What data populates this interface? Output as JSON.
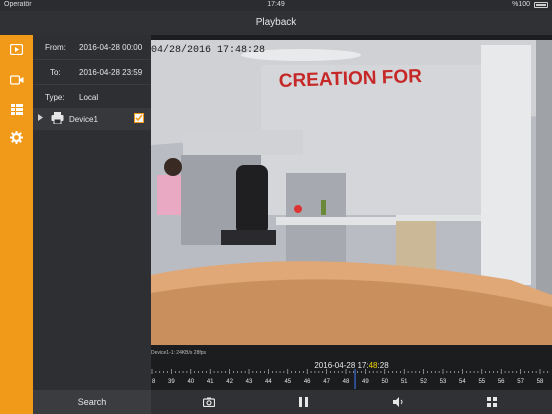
{
  "status": {
    "carrier": "Operatör",
    "time": "17:49",
    "battery": "%100"
  },
  "title": "Playback",
  "rail": {
    "icons": [
      "playback-icon",
      "camera-icon",
      "list-icon",
      "settings-icon"
    ]
  },
  "filters": {
    "from": {
      "label": "From:",
      "value": "2016-04-28 00:00"
    },
    "to": {
      "label": "To:",
      "value": "2016-04-28 23:59"
    },
    "type": {
      "label": "Type:",
      "value": "Local"
    }
  },
  "device": {
    "name": "Device1",
    "checked": true
  },
  "search_label": "Search",
  "video": {
    "overlay_timestamp": "04/28/2016 17:48:28",
    "sign_text": "CREATION FOR"
  },
  "stream_info": "Device1-1: 24KB/s 28fps",
  "timeline": {
    "date": "2016-04-28 17:",
    "minute": "48",
    "seconds": ":28",
    "ticks": [
      "8",
      "39",
      "40",
      "41",
      "42",
      "43",
      "44",
      "45",
      "46",
      "47",
      "48",
      "49",
      "50",
      "51",
      "52",
      "53",
      "54",
      "55",
      "56",
      "57",
      "58"
    ]
  },
  "controls": [
    "snapshot-icon",
    "pause-icon",
    "volume-icon",
    "split-screen-icon"
  ],
  "colors": {
    "accent": "#f19a1a",
    "sign_red": "#c62828"
  }
}
